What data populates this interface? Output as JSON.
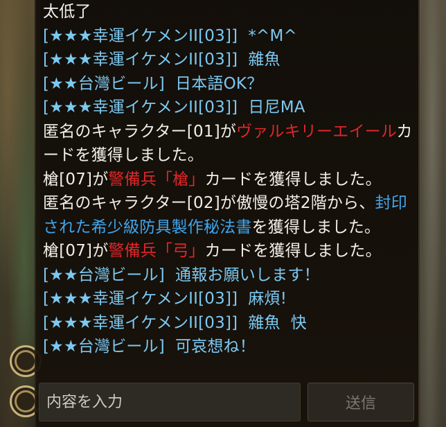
{
  "chat": {
    "messages": [
      [
        {
          "text": "太低了",
          "color": "white"
        }
      ],
      [
        {
          "text": "[★★★幸運イケメンII[03]]  *^M^",
          "color": "cyan"
        }
      ],
      [
        {
          "text": "[★★★幸運イケメンII[03]]  雜魚",
          "color": "cyan"
        }
      ],
      [
        {
          "text": "[★★台灣ビール]  日本語OK？",
          "color": "cyan"
        }
      ],
      [
        {
          "text": "[★★★幸運イケメンII[03]]  日尼MA",
          "color": "cyan"
        }
      ],
      [
        {
          "text": "匿名のキャラクター[01]が",
          "color": "white"
        },
        {
          "text": "ヴァルキリーエイール",
          "color": "red"
        },
        {
          "text": "カードを獲得しました。",
          "color": "white"
        }
      ],
      [
        {
          "text": "槍[07]が",
          "color": "white"
        },
        {
          "text": "警備兵「槍」",
          "color": "red"
        },
        {
          "text": "カードを獲得しました。",
          "color": "white"
        }
      ],
      [
        {
          "text": "匿名のキャラクター[02]が傲慢の塔2階から、",
          "color": "white"
        },
        {
          "text": "封印された希少級防具製作秘法書",
          "color": "blue"
        },
        {
          "text": "を獲得しました。",
          "color": "white"
        }
      ],
      [
        {
          "text": "槍[07]が",
          "color": "white"
        },
        {
          "text": "警備兵「弓」",
          "color": "red"
        },
        {
          "text": "カードを獲得しました。",
          "color": "white"
        }
      ],
      [
        {
          "text": "[★★台灣ビール]  通報お願いします！",
          "color": "cyan"
        }
      ],
      [
        {
          "text": "[★★★幸運イケメンII[03]]  麻煩!",
          "color": "cyan"
        }
      ],
      [
        {
          "text": "[★★★幸運イケメンII[03]]  雜魚  快",
          "color": "cyan"
        }
      ],
      [
        {
          "text": "[★★台灣ビール]  可哀想ね！",
          "color": "cyan"
        }
      ]
    ]
  },
  "input": {
    "placeholder": "内容を入力",
    "value": ""
  },
  "send_button": {
    "label": "送信"
  }
}
